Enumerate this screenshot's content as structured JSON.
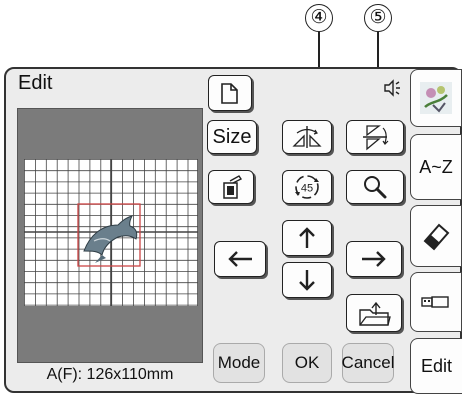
{
  "callouts": {
    "c4": "④",
    "c5": "⑤"
  },
  "screen": {
    "title": "Edit",
    "size_readout": "A(F): 126x110mm"
  },
  "buttons": {
    "size_label": "Size",
    "mode_label": "Mode",
    "ok_label": "OK",
    "cancel_label": "Cancel"
  },
  "tabs": {
    "character_label": "A~Z",
    "edit_label": "Edit"
  },
  "icons": {
    "layout": "layout-icon",
    "flip": "flip-horizontal-icon",
    "rotate_90": "rotate-90-icon",
    "delete": "delete-icon",
    "rotate_45": "rotate-45-icon",
    "zoom": "magnifier-icon",
    "up": "arrow-up-icon",
    "down": "arrow-down-icon",
    "left": "arrow-left-icon",
    "right": "arrow-right-icon",
    "center": "center-reset-icon",
    "speaker": "speaker-icon",
    "pattern": "embroidery-pattern-icon",
    "eraser": "eraser-icon",
    "usb": "usb-icon",
    "rotate_45_text": "45"
  },
  "colors": {
    "frame_bg": "#ececec",
    "preview_bg": "#7b7b7b",
    "button_bg": "#fdfdfd",
    "bottom_button_bg": "#e2e2e2"
  }
}
